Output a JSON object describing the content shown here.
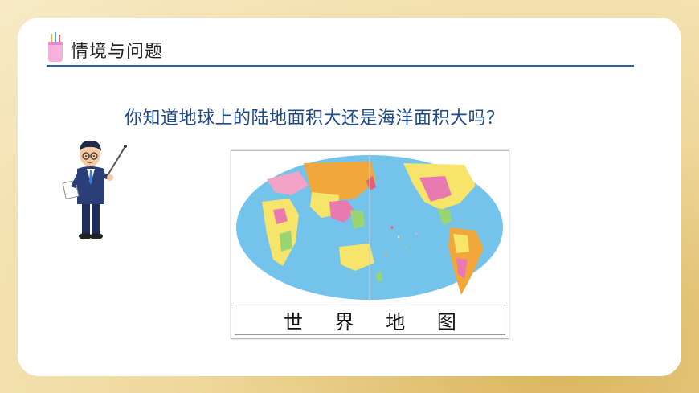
{
  "section": {
    "title": "情境与问题",
    "icon": "pencil-cup-icon"
  },
  "question": "你知道地球上的陆地面积大还是海洋面积大吗？",
  "map": {
    "caption": "世 界 地 图"
  },
  "colors": {
    "rule": "#2f5f9a",
    "question_text": "#1d4a8a",
    "ocean": "#74c3ea",
    "frame": "#f2d98f"
  },
  "illustration": "teacher-with-pointer"
}
